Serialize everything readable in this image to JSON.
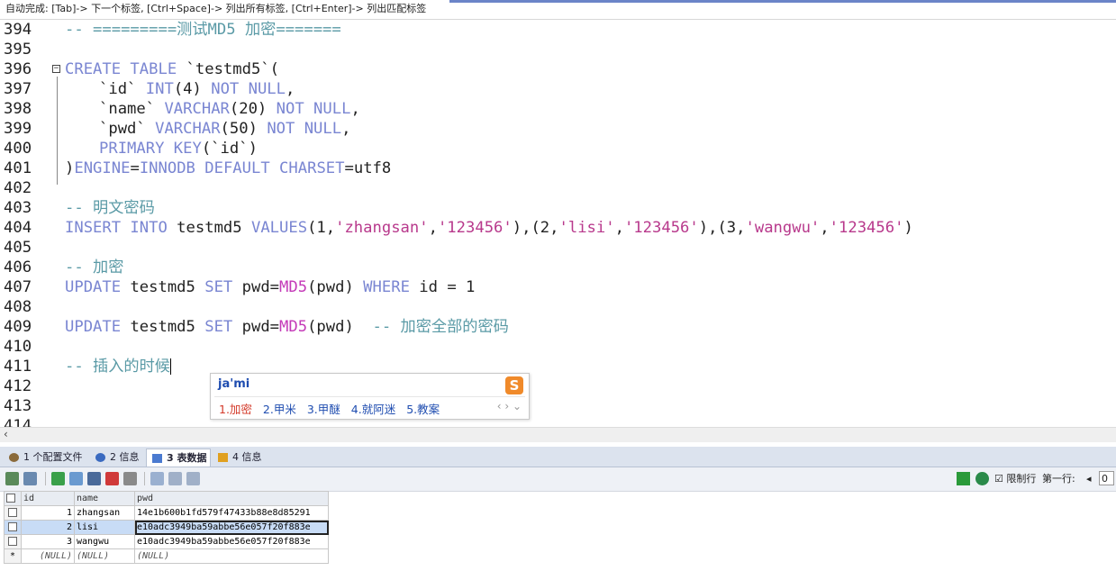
{
  "hint_bar": {
    "text": "自动完成: [Tab]-> 下一个标签, [Ctrl+Space]-> 列出所有标签, [Ctrl+Enter]-> 列出匹配标签"
  },
  "editor": {
    "line_numbers": [
      "394",
      "395",
      "396",
      "397",
      "398",
      "399",
      "400",
      "401",
      "402",
      "403",
      "404",
      "405",
      "406",
      "407",
      "408",
      "409",
      "410",
      "411",
      "412",
      "413",
      "414"
    ],
    "line394": "-- =========测试MD5 加密=======",
    "line396": {
      "kw1": "CREATE TABLE",
      "rest": " `testmd5`("
    },
    "line397": {
      "name": "`id`",
      "type": "INT",
      "args": "(4)",
      "constraint": "NOT NULL",
      "comma": ","
    },
    "line398": {
      "name": "`name`",
      "type": "VARCHAR",
      "args": "(20)",
      "constraint": "NOT NULL",
      "comma": ","
    },
    "line399": {
      "name": "`pwd`",
      "type": "VARCHAR",
      "args": "(50)",
      "constraint": "NOT NULL",
      "comma": ","
    },
    "line400": {
      "kw": "PRIMARY KEY",
      "rest": "(`id`)"
    },
    "line401": {
      "paren": ")",
      "kw1": "ENGINE",
      "eq1": "=",
      "kw2": "INNODB",
      "kw3": "DEFAULT CHARSET",
      "eq2": "=",
      "val": "utf8"
    },
    "line403": "-- 明文密码",
    "line404": {
      "kw1": "INSERT INTO",
      "tbl": " testmd5 ",
      "kw2": "VALUES",
      "p1": "(1,",
      "s1": "'zhangsan'",
      "c1": ",",
      "s2": "'123456'",
      "p2": "),(2,",
      "s3": "'lisi'",
      "c2": ",",
      "s4": "'123456'",
      "p3": "),(3,",
      "s5": "'wangwu'",
      "c3": ",",
      "s6": "'123456'",
      "p4": ")"
    },
    "line406": "-- 加密",
    "line407": {
      "kw1": "UPDATE",
      "tbl": " testmd5 ",
      "kw2": "SET",
      "a1": " pwd=",
      "fn": "MD5",
      "a2": "(pwd) ",
      "kw3": "WHERE",
      "a3": " id = 1"
    },
    "line409": {
      "kw1": "UPDATE",
      "tbl": " testmd5 ",
      "kw2": "SET",
      "a1": " pwd=",
      "fn": "MD5",
      "a2": "(pwd)  ",
      "cm": "-- 加密全部的密码"
    },
    "line411": "-- 插入的时候"
  },
  "ime": {
    "pinyin": "ja'mi",
    "candidates": [
      "1.加密",
      "2.甲米",
      "3.甲醚",
      "4.就阿迷",
      "5.教案"
    ],
    "nav": "‹ › ⌄"
  },
  "result_tabs": [
    {
      "label": "1 个配置文件",
      "icon": "config-icon"
    },
    {
      "label": "2 信息",
      "icon": "info-icon"
    },
    {
      "label": "3 表数据",
      "icon": "table-icon"
    },
    {
      "label": "4 信息",
      "icon": "info-icon"
    }
  ],
  "toolbar_right": {
    "limit_label": "限制行",
    "first_row_label": "第一行:",
    "first_row_value": "0"
  },
  "table": {
    "columns": [
      "id",
      "name",
      "pwd"
    ],
    "rows": [
      [
        "1",
        "zhangsan",
        "14e1b600b1fd579f47433b88e8d85291"
      ],
      [
        "2",
        "lisi",
        "e10adc3949ba59abbe56e057f20f883e"
      ],
      [
        "3",
        "wangwu",
        "e10adc3949ba59abbe56e057f20f883e"
      ]
    ],
    "new_row": [
      "(NULL)",
      "(NULL)",
      "(NULL)"
    ],
    "new_row_marker": "*"
  },
  "colors": {
    "keyword": "#7a86d2",
    "comment": "#5a9aa6",
    "string": "#b8398c",
    "function": "#c43ab8"
  }
}
